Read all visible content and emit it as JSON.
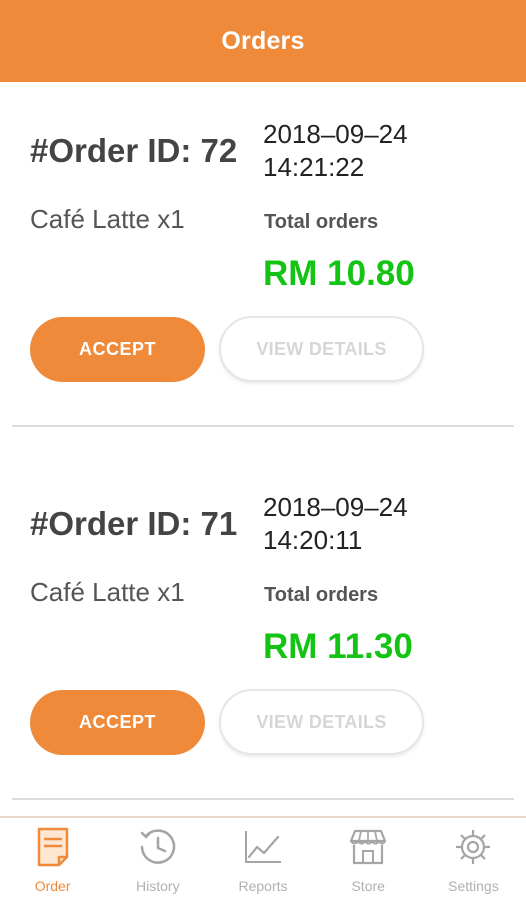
{
  "header": {
    "title": "Orders"
  },
  "orders": [
    {
      "order_id": "#Order ID: 72",
      "date": "2018–09–24",
      "time": "14:21:22",
      "items": "Café Latte x1",
      "total_label": "Total orders",
      "total_value": "RM 10.80",
      "accept_label": "ACCEPT",
      "details_label": "VIEW DETAILS"
    },
    {
      "order_id": "#Order ID: 71",
      "date": "2018–09–24",
      "time": "14:20:11",
      "items": "Café Latte x1",
      "total_label": "Total orders",
      "total_value": "RM 11.30",
      "accept_label": "ACCEPT",
      "details_label": "VIEW DETAILS"
    }
  ],
  "bottom_nav": {
    "active": "order",
    "items": [
      {
        "label": "Order",
        "icon": "order-receipt-icon"
      },
      {
        "label": "History",
        "icon": "history-clock-icon"
      },
      {
        "label": "Reports",
        "icon": "reports-chart-icon"
      },
      {
        "label": "Store",
        "icon": "store-icon"
      },
      {
        "label": "Settings",
        "icon": "settings-gear-icon"
      }
    ]
  },
  "colors": {
    "accent": "#ee8a3a",
    "price": "#14c414",
    "nav_inactive": "#b0b0b0"
  }
}
